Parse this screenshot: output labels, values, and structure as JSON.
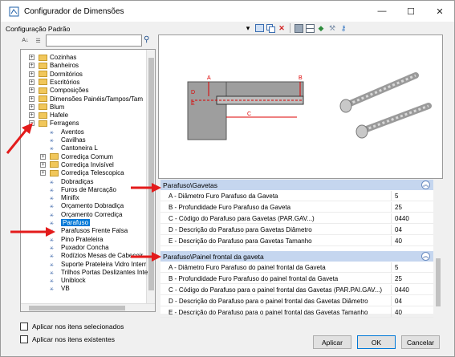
{
  "window": {
    "title": "Configurador de Dimensões",
    "minimize": "—",
    "maximize": "☐",
    "close": "✕"
  },
  "toolbar": {
    "label": "Configuração Padrão"
  },
  "tree": {
    "items": [
      {
        "label": "Cozinhas",
        "kind": "folder"
      },
      {
        "label": "Banheiros",
        "kind": "folder"
      },
      {
        "label": "Dormitórios",
        "kind": "folder"
      },
      {
        "label": "Escritórios",
        "kind": "folder"
      },
      {
        "label": "Composições",
        "kind": "folder"
      },
      {
        "label": "Dimensões Painéis/Tampos/Tam",
        "kind": "folder"
      },
      {
        "label": "Blum",
        "kind": "folder"
      },
      {
        "label": "Hafele",
        "kind": "folder"
      },
      {
        "label": "Ferragens",
        "kind": "folder"
      },
      {
        "label": "Aventos",
        "kind": "part"
      },
      {
        "label": "Cavilhas",
        "kind": "part"
      },
      {
        "label": "Cantoneira L",
        "kind": "part"
      },
      {
        "label": "Corrediça Comum",
        "kind": "folder"
      },
      {
        "label": "Corrediça Invisível",
        "kind": "folder"
      },
      {
        "label": "Corrediça Telescopica",
        "kind": "folder"
      },
      {
        "label": "Dobradiças",
        "kind": "part"
      },
      {
        "label": "Furos de Marcação",
        "kind": "part"
      },
      {
        "label": "Minifix",
        "kind": "part"
      },
      {
        "label": "Orçamento Dobradiça",
        "kind": "part"
      },
      {
        "label": "Orçamento Corrediça",
        "kind": "part"
      },
      {
        "label": "Parafuso",
        "kind": "part"
      },
      {
        "label": "Parafusos Frente Falsa",
        "kind": "part"
      },
      {
        "label": "Pino Prateleira",
        "kind": "part"
      },
      {
        "label": "Puxador Concha",
        "kind": "part"
      },
      {
        "label": "Rodízios Mesas de Cabeceir",
        "kind": "part"
      },
      {
        "label": "Suporte Prateleira Vidro Interr",
        "kind": "part"
      },
      {
        "label": "Trilhos Portas Deslizantes Inte",
        "kind": "part"
      },
      {
        "label": "Uniblock",
        "kind": "part"
      },
      {
        "label": "VB",
        "kind": "part"
      }
    ],
    "selected": "Parafuso"
  },
  "preview": {
    "label_a": "A",
    "label_b": "B",
    "label_c": "C",
    "label_d": "D",
    "label_e": "E"
  },
  "groups": [
    {
      "title": "Parafuso\\Gavetas",
      "rows": [
        {
          "label": "A - Diâmetro Furo Parafuso da Gaveta",
          "value": "5"
        },
        {
          "label": "B - Profundidade Furo Parafuso da Gaveta",
          "value": "25"
        },
        {
          "label": "C - Código do Parafuso para Gavetas (PAR.GAV...)",
          "value": "0440"
        },
        {
          "label": "D - Descrição do Parafuso para Gavetas Diâmetro",
          "value": "04"
        },
        {
          "label": "E - Descrição do Parafuso para Gavetas Tamanho",
          "value": "40"
        }
      ]
    },
    {
      "title": "Parafuso\\Painel frontal da gaveta",
      "rows": [
        {
          "label": "A - Diâmetro Furo Parafuso do painel frontal da Gaveta",
          "value": "5"
        },
        {
          "label": "B - Profundidade Furo Parafuso do painel frontal da Gaveta",
          "value": "25"
        },
        {
          "label": "C - Código do Parafuso para o painel frontal das Gavetas (PAR.PAI.GAV...)",
          "value": "0440"
        },
        {
          "label": "D - Descrição do Parafuso para o painel frontal das Gavetas Diâmetro",
          "value": "04"
        },
        {
          "label": "E - Descrição do Parafuso para o painel frontal das Gavetas Tamanho",
          "value": "40"
        }
      ]
    }
  ],
  "checkboxes": {
    "selected_items": "Aplicar nos itens selecionados",
    "existing_items": "Aplicar nos itens existentes"
  },
  "buttons": {
    "apply": "Aplicar",
    "ok": "OK",
    "cancel": "Cancelar"
  },
  "colors": {
    "selection": "#0078d7",
    "group_header": "#c5d6ef",
    "annotation_arrow": "#e31b1b"
  }
}
